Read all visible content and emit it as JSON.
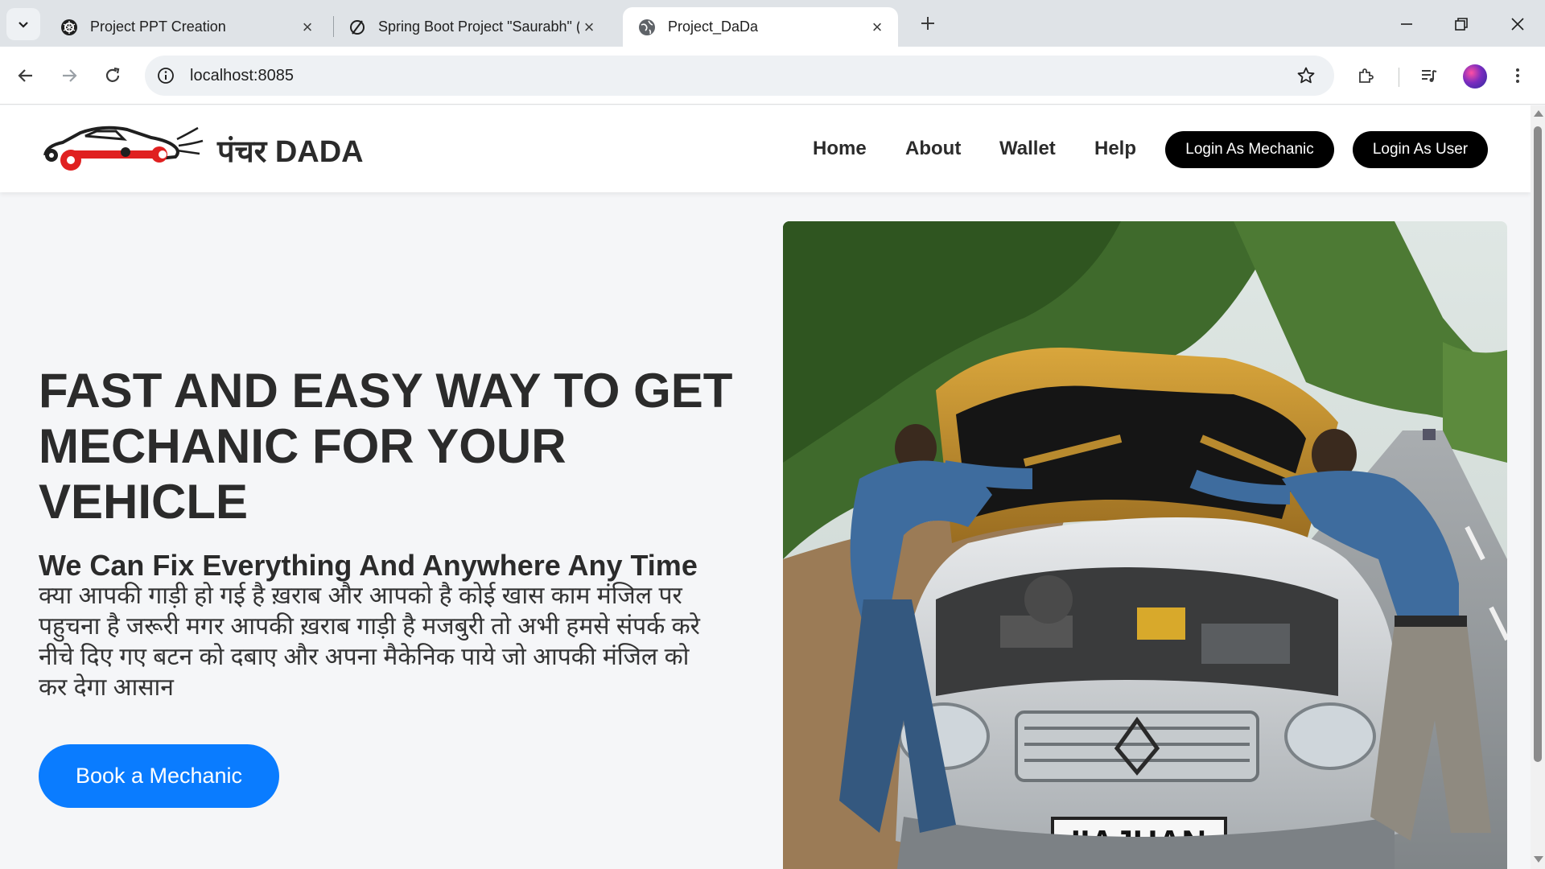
{
  "browser": {
    "tabs": [
      {
        "title": "Project PPT Creation",
        "favicon": "openai-icon",
        "active": false
      },
      {
        "title": "Spring Boot Project \"Saurabh\" (",
        "favicon": "perplexity-icon",
        "active": false
      },
      {
        "title": "Project_DaDa",
        "favicon": "globe-icon",
        "active": true
      }
    ],
    "url": "localhost:8085"
  },
  "header": {
    "brand": "पंचर DADA",
    "nav": [
      "Home",
      "About",
      "Wallet",
      "Help"
    ],
    "login_mechanic": "Login As Mechanic",
    "login_user": "Login As User"
  },
  "hero": {
    "title": "FAST AND EASY WAY TO GET MECHANIC FOR YOUR VEHICLE",
    "subtitle": "We Can Fix Everything And Anywhere Any Time",
    "description": "क्या आपकी गाड़ी हो गई है ख़राब और आपको है कोई खास काम मंजिल पर पहुचना है जरूरी मगर आपकी ख़राब गाड़ी है मजबुरी तो अभी हमसे संपर्क करे नीचे दिए गए बटन को दबाए और अपना मैकेनिक पाये जो आपकी मंजिल को कर देगा आसान",
    "cta": "Book a Mechanic",
    "image_plate": "IIAJHAN"
  },
  "colors": {
    "cta_blue": "#0a7cff",
    "pill_black": "#000000",
    "logo_red": "#e02020"
  }
}
